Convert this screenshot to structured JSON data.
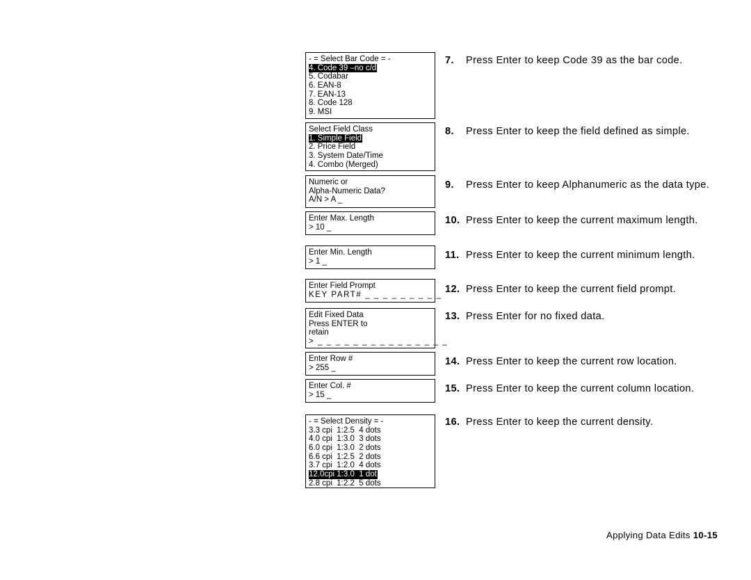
{
  "document": {
    "footer": {
      "chapter_title": "Applying Data Edits",
      "page_number": "10-15"
    }
  },
  "lcd_screens": [
    {
      "name": "select-bar-code",
      "lines": [
        {
          "text": "- = Select Bar Code = -",
          "selected": false
        },
        {
          "text": "4. Code 39 –no c/d",
          "selected": true
        },
        {
          "text": "5. Codabar",
          "selected": false
        },
        {
          "text": "6. EAN-8",
          "selected": false
        },
        {
          "text": "7. EAN-13",
          "selected": false
        },
        {
          "text": "8. Code 128",
          "selected": false
        },
        {
          "text": "9. MSI",
          "selected": false
        }
      ]
    },
    {
      "name": "select-field-class",
      "lines": [
        {
          "text": "Select Field Class",
          "selected": false
        },
        {
          "text": "1. Simple Field",
          "selected": true
        },
        {
          "text": "2. Price Field",
          "selected": false
        },
        {
          "text": "3. System Date/Time",
          "selected": false
        },
        {
          "text": "4. Combo (Merged)",
          "selected": false
        }
      ]
    },
    {
      "name": "data-type-prompt",
      "lines": [
        {
          "text": "Numeric or",
          "selected": false
        },
        {
          "text": "Alpha-Numeric Data?",
          "selected": false
        },
        {
          "text": "A/N > A _",
          "selected": false
        }
      ]
    },
    {
      "name": "max-length-prompt",
      "lines": [
        {
          "text": "Enter Max. Length",
          "selected": false
        },
        {
          "text": "> 10 _",
          "selected": false
        }
      ]
    },
    {
      "name": "min-length-prompt",
      "lines": [
        {
          "text": "Enter Min. Length",
          "selected": false
        },
        {
          "text": "> 1 _",
          "selected": false
        }
      ]
    },
    {
      "name": "field-prompt-prompt",
      "lines": [
        {
          "text": "Enter Field Prompt",
          "selected": false
        },
        {
          "text": "KEY PART# _ _ _ _ _ _ _ _ _",
          "selected": false
        }
      ]
    },
    {
      "name": "edit-fixed-data-prompt",
      "lines": [
        {
          "text": "Edit Fixed Data",
          "selected": false
        },
        {
          "text": "Press ENTER to",
          "selected": false
        },
        {
          "text": "retain",
          "selected": false
        },
        {
          "text": "> _ _ _ _ _ _ _ _ _ _ _ _ _ _ _",
          "selected": false
        }
      ]
    },
    {
      "name": "row-number-prompt",
      "lines": [
        {
          "text": "Enter Row #",
          "selected": false
        },
        {
          "text": "> 255 _",
          "selected": false
        }
      ]
    },
    {
      "name": "column-number-prompt",
      "lines": [
        {
          "text": "Enter Col. #",
          "selected": false
        },
        {
          "text": "> 15 _",
          "selected": false
        }
      ]
    },
    {
      "name": "select-density",
      "lines": [
        {
          "text": "- = Select Density = -",
          "selected": false
        },
        {
          "text": "3.3 cpi  1:2.5  4 dots",
          "selected": false
        },
        {
          "text": "4.0 cpi  1:3.0  3 dots",
          "selected": false
        },
        {
          "text": "6.0 cpi  1:3.0  2 dots",
          "selected": false
        },
        {
          "text": "6.6 cpi  1:2.5  2 dots",
          "selected": false
        },
        {
          "text": "3.7 cpi  1:2.0  4 dots",
          "selected": false
        },
        {
          "text": "12.0cpi 1:3.0  1 dot",
          "selected": true
        },
        {
          "text": "2.8 cpi  1:2.2  5 dots",
          "selected": false
        }
      ]
    }
  ],
  "steps": [
    {
      "number": "7.",
      "text": "Press Enter to keep Code 39 as the bar code."
    },
    {
      "number": "8.",
      "text": "Press Enter to keep the field defined as simple."
    },
    {
      "number": "9.",
      "text": "Press Enter to keep Alphanumeric as the data type."
    },
    {
      "number": "10.",
      "text": "Press Enter to keep the current maximum length."
    },
    {
      "number": "11.",
      "text": "Press Enter to keep the current minimum length."
    },
    {
      "number": "12.",
      "text": "Press Enter to keep the current field prompt."
    },
    {
      "number": "13.",
      "text": "Press Enter for no fixed data."
    },
    {
      "number": "14.",
      "text": "Press Enter to keep the current row location."
    },
    {
      "number": "15.",
      "text": "Press Enter to keep the current column location."
    },
    {
      "number": "16.",
      "text": "Press Enter to keep the current density."
    }
  ]
}
